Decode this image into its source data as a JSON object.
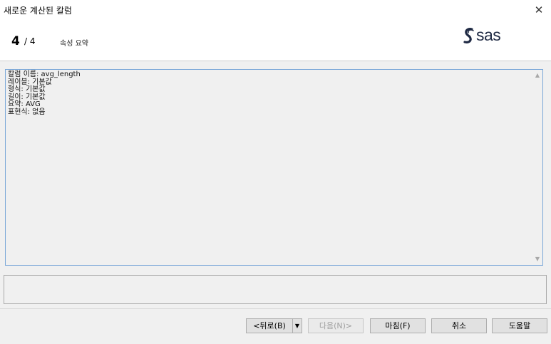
{
  "window": {
    "title": "새로운 계산된 칼럼",
    "close_glyph": "✕"
  },
  "header": {
    "step_current": "4",
    "step_total": "/ 4",
    "step_title": "속성 요약",
    "logo_text": "sas",
    "logo_color": "#1f2a44"
  },
  "summary": {
    "lines": "칼럼 이름: avg_length\n레이블: 기본값\n형식: 기본값\n길이: 기본값\n요약: AVG\n표현식: 없음",
    "scroll_up_glyph": "▲",
    "scroll_down_glyph": "▼"
  },
  "description": {
    "text": ""
  },
  "buttons": {
    "back": "<뒤로(B)",
    "back_dropdown": "▼",
    "next": "다음(N)>",
    "finish": "마침(F)",
    "cancel": "취소",
    "help": "도움말"
  },
  "colors": {
    "summary_border": "#7aa7d8",
    "window_bg": "#f0f0f0"
  }
}
